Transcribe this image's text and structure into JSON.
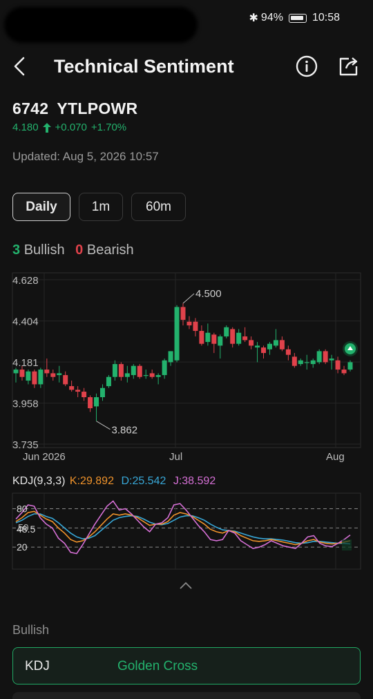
{
  "status": {
    "battery": "94%",
    "time": "10:58"
  },
  "header": {
    "title": "Technical Sentiment"
  },
  "stock": {
    "code": "6742",
    "symbol": "YTLPOWR",
    "price": "4.180",
    "change": "+0.070",
    "change_pct": "+1.70%"
  },
  "updated": "Updated: Aug 5, 2026 10:57",
  "tabs": [
    {
      "label": "Daily",
      "active": true
    },
    {
      "label": "1m",
      "active": false
    },
    {
      "label": "60m",
      "active": false
    }
  ],
  "sentiment": {
    "bullish_count": "3",
    "bullish_label": "Bullish",
    "bearish_count": "0",
    "bearish_label": "Bearish"
  },
  "chart_data": {
    "type": "candlestick",
    "y_ticks": [
      "4.628",
      "4.404",
      "4.181",
      "3.958",
      "3.735"
    ],
    "ylim": [
      3.735,
      4.628
    ],
    "x_ticks": [
      "Jun 2026",
      "Jul",
      "Aug"
    ],
    "high_label": "4.500",
    "low_label": "3.862",
    "up_color": "#23b26d",
    "down_color": "#e0424b",
    "signal_marker": "bullish-up-arrow",
    "candles": [
      {
        "o": 4.12,
        "h": 4.15,
        "l": 4.07,
        "c": 4.14
      },
      {
        "o": 4.14,
        "h": 4.16,
        "l": 4.08,
        "c": 4.1
      },
      {
        "o": 4.08,
        "h": 4.14,
        "l": 4.06,
        "c": 4.13
      },
      {
        "o": 4.13,
        "h": 4.14,
        "l": 4.04,
        "c": 4.06
      },
      {
        "o": 4.06,
        "h": 4.15,
        "l": 4.04,
        "c": 4.14
      },
      {
        "o": 4.14,
        "h": 4.2,
        "l": 4.1,
        "c": 4.12
      },
      {
        "o": 4.12,
        "h": 4.14,
        "l": 4.08,
        "c": 4.1
      },
      {
        "o": 4.11,
        "h": 4.16,
        "l": 4.07,
        "c": 4.12
      },
      {
        "o": 4.11,
        "h": 4.13,
        "l": 4.05,
        "c": 4.06
      },
      {
        "o": 4.05,
        "h": 4.08,
        "l": 4.02,
        "c": 4.03
      },
      {
        "o": 4.03,
        "h": 4.05,
        "l": 3.99,
        "c": 4.02
      },
      {
        "o": 4.02,
        "h": 4.04,
        "l": 3.97,
        "c": 3.99
      },
      {
        "o": 3.99,
        "h": 4.0,
        "l": 3.91,
        "c": 3.93
      },
      {
        "o": 3.94,
        "h": 4.01,
        "l": 3.86,
        "c": 3.99
      },
      {
        "o": 3.99,
        "h": 4.06,
        "l": 3.97,
        "c": 4.04
      },
      {
        "o": 4.05,
        "h": 4.11,
        "l": 4.04,
        "c": 4.1
      },
      {
        "o": 4.1,
        "h": 4.19,
        "l": 4.08,
        "c": 4.17
      },
      {
        "o": 4.17,
        "h": 4.18,
        "l": 4.08,
        "c": 4.1
      },
      {
        "o": 4.1,
        "h": 4.16,
        "l": 4.07,
        "c": 4.12
      },
      {
        "o": 4.11,
        "h": 4.17,
        "l": 4.09,
        "c": 4.16
      },
      {
        "o": 4.16,
        "h": 4.17,
        "l": 4.09,
        "c": 4.1
      },
      {
        "o": 4.11,
        "h": 4.14,
        "l": 4.09,
        "c": 4.11
      },
      {
        "o": 4.12,
        "h": 4.14,
        "l": 4.09,
        "c": 4.1
      },
      {
        "o": 4.1,
        "h": 4.12,
        "l": 4.06,
        "c": 4.11
      },
      {
        "o": 4.11,
        "h": 4.2,
        "l": 4.09,
        "c": 4.19
      },
      {
        "o": 4.18,
        "h": 4.24,
        "l": 4.16,
        "c": 4.24
      },
      {
        "o": 4.19,
        "h": 4.49,
        "l": 4.18,
        "c": 4.48
      },
      {
        "o": 4.48,
        "h": 4.5,
        "l": 4.38,
        "c": 4.41
      },
      {
        "o": 4.4,
        "h": 4.43,
        "l": 4.36,
        "c": 4.38
      },
      {
        "o": 4.4,
        "h": 4.42,
        "l": 4.32,
        "c": 4.35
      },
      {
        "o": 4.35,
        "h": 4.38,
        "l": 4.27,
        "c": 4.28
      },
      {
        "o": 4.29,
        "h": 4.39,
        "l": 4.27,
        "c": 4.34
      },
      {
        "o": 4.33,
        "h": 4.34,
        "l": 4.23,
        "c": 4.28
      },
      {
        "o": 4.27,
        "h": 4.33,
        "l": 4.2,
        "c": 4.32
      },
      {
        "o": 4.32,
        "h": 4.38,
        "l": 4.31,
        "c": 4.37
      },
      {
        "o": 4.36,
        "h": 4.37,
        "l": 4.26,
        "c": 4.28
      },
      {
        "o": 4.28,
        "h": 4.36,
        "l": 4.27,
        "c": 4.34
      },
      {
        "o": 4.32,
        "h": 4.37,
        "l": 4.29,
        "c": 4.3
      },
      {
        "o": 4.3,
        "h": 4.32,
        "l": 4.25,
        "c": 4.27
      },
      {
        "o": 4.26,
        "h": 4.29,
        "l": 4.18,
        "c": 4.27
      },
      {
        "o": 4.26,
        "h": 4.27,
        "l": 4.2,
        "c": 4.23
      },
      {
        "o": 4.25,
        "h": 4.29,
        "l": 4.22,
        "c": 4.28
      },
      {
        "o": 4.27,
        "h": 4.36,
        "l": 4.26,
        "c": 4.3
      },
      {
        "o": 4.3,
        "h": 4.32,
        "l": 4.24,
        "c": 4.25
      },
      {
        "o": 4.25,
        "h": 4.27,
        "l": 4.19,
        "c": 4.22
      },
      {
        "o": 4.21,
        "h": 4.23,
        "l": 4.15,
        "c": 4.16
      },
      {
        "o": 4.17,
        "h": 4.2,
        "l": 4.16,
        "c": 4.19
      },
      {
        "o": 4.18,
        "h": 4.22,
        "l": 4.14,
        "c": 4.18
      },
      {
        "o": 4.17,
        "h": 4.2,
        "l": 4.15,
        "c": 4.19
      },
      {
        "o": 4.18,
        "h": 4.25,
        "l": 4.17,
        "c": 4.24
      },
      {
        "o": 4.24,
        "h": 4.25,
        "l": 4.17,
        "c": 4.18
      },
      {
        "o": 4.19,
        "h": 4.22,
        "l": 4.14,
        "c": 4.2
      },
      {
        "o": 4.19,
        "h": 4.21,
        "l": 4.12,
        "c": 4.14
      },
      {
        "o": 4.14,
        "h": 4.16,
        "l": 4.11,
        "c": 4.12
      },
      {
        "o": 4.14,
        "h": 4.19,
        "l": 4.13,
        "c": 4.18
      }
    ]
  },
  "kdj": {
    "label": "KDJ(9,3,3)",
    "k_label": "K:29.892",
    "d_label": "D:25.542",
    "j_label": "J:38.592",
    "k_color": "#f0932b",
    "d_color": "#38a8d8",
    "j_color": "#d670d6",
    "levels": [
      "80",
      "48.5",
      "20"
    ],
    "level_50": "50",
    "k": [
      60,
      66,
      74,
      76,
      70,
      64,
      60,
      50,
      42,
      32,
      28,
      30,
      36,
      44,
      54,
      64,
      72,
      70,
      72,
      70,
      66,
      60,
      54,
      56,
      56,
      60,
      70,
      74,
      72,
      68,
      62,
      56,
      48,
      44,
      42,
      46,
      44,
      38,
      34,
      30,
      29,
      30,
      32,
      30,
      28,
      26,
      24,
      26,
      30,
      32,
      28,
      26,
      25,
      26,
      28,
      30
    ],
    "d": [
      58,
      62,
      68,
      72,
      72,
      68,
      65,
      58,
      50,
      42,
      36,
      33,
      34,
      38,
      46,
      54,
      62,
      66,
      68,
      69,
      68,
      64,
      59,
      56,
      55,
      57,
      62,
      67,
      69,
      69,
      66,
      62,
      56,
      51,
      47,
      46,
      45,
      42,
      39,
      36,
      34,
      33,
      33,
      32,
      31,
      29,
      27,
      26,
      27,
      29,
      29,
      28,
      27,
      26,
      26,
      25
    ],
    "j": [
      64,
      74,
      86,
      84,
      66,
      56,
      50,
      34,
      26,
      12,
      10,
      24,
      40,
      56,
      70,
      84,
      92,
      78,
      80,
      72,
      62,
      52,
      44,
      56,
      58,
      66,
      86,
      88,
      78,
      66,
      54,
      44,
      32,
      30,
      32,
      46,
      42,
      30,
      24,
      18,
      20,
      24,
      30,
      26,
      22,
      20,
      18,
      26,
      36,
      38,
      26,
      22,
      21,
      26,
      32,
      39
    ]
  },
  "bullish_section": {
    "heading": "Bullish"
  },
  "signals": [
    {
      "indicator": "KDJ",
      "signal": "Golden Cross"
    }
  ]
}
